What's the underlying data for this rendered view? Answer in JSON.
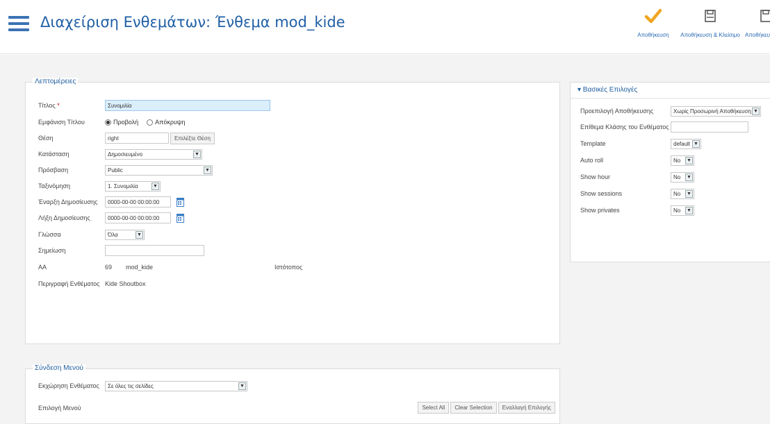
{
  "header": {
    "title": "Διαχείριση Ενθεμάτων: Ένθεμα mod_kide",
    "toolbar": [
      {
        "label": "Αποθήκευση",
        "icon": "checkmark-icon",
        "color": "#f0a521"
      },
      {
        "label": "Αποθήκευση & Κλείσιμο",
        "icon": "save-icon",
        "color": "#555"
      },
      {
        "label": "Αποθήκευση",
        "icon": "save-icon",
        "color": "#555"
      }
    ]
  },
  "details": {
    "legend": "Λεπτομέρειες",
    "title_label": "Τίτλος",
    "title_required": "*",
    "title_value": "Συνομιλία",
    "show_title_label": "Εμφάνιση Τίτλου",
    "show_title_options": [
      "Προβολή",
      "Απόκρυψη"
    ],
    "show_title_selected": "Προβολή",
    "position_label": "Θέση",
    "position_value": "right",
    "position_button": "Επιλέξτε Θέση",
    "state_label": "Κατάσταση",
    "state_value": "Δημοσιευμένο",
    "access_label": "Πρόσβαση",
    "access_value": "Public",
    "ordering_label": "Ταξινόμηση",
    "ordering_value": "1. Συνομιλία",
    "publish_start_label": "Έναρξη Δημοσίευσης",
    "publish_start_value": "0000-00-00 00:00:00",
    "publish_end_label": "Λήξη Δημοσίευσης",
    "publish_end_value": "0000-00-00 00:00:00",
    "language_label": "Γλώσσα",
    "language_value": "Όλα",
    "note_label": "Σημείωση",
    "note_value": "",
    "id_label": "ΑΑ",
    "id_value": "69",
    "module_name": "mod_kide",
    "site_label": "Ιστότοπος",
    "description_label": "Περιγραφή Ενθέματος",
    "description_value": "Kide Shoutbox"
  },
  "menu_assignment": {
    "legend": "Σύνδεση Μενού",
    "assignment_label": "Εκχώρηση Ενθέματος",
    "assignment_value": "Σε όλες τις σελίδες",
    "selection_label": "Επιλογή Μενού",
    "buttons": [
      "Select All",
      "Clear Selection",
      "Εναλλαγή Επιλογής"
    ]
  },
  "basic_options": {
    "heading": "▾ Βασικές Επιλογές",
    "rows": [
      {
        "label": "Προεπιλογή Αποθήκευσης",
        "value": "Χωρίς Προσωρινή Αποθήκευση",
        "type": "select"
      },
      {
        "label": "Επίθεμα Κλάσης του Ενθέματος",
        "value": "",
        "type": "input"
      },
      {
        "label": "Template",
        "value": "default",
        "type": "select"
      },
      {
        "label": "Auto roll",
        "value": "No",
        "type": "select"
      },
      {
        "label": "Show hour",
        "value": "No",
        "type": "select"
      },
      {
        "label": "Show sessions",
        "value": "No",
        "type": "select"
      },
      {
        "label": "Show privates",
        "value": "No",
        "type": "select"
      }
    ]
  }
}
